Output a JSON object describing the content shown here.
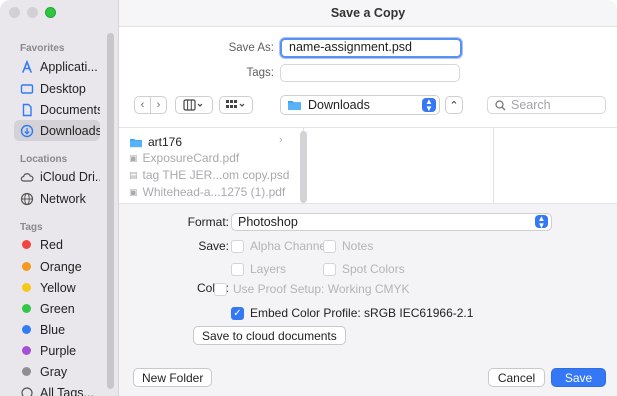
{
  "window": {
    "title": "Save a Copy"
  },
  "sidebar": {
    "favorites_label": "Favorites",
    "favorites": [
      {
        "label": "Applicati...",
        "icon": "applications-icon"
      },
      {
        "label": "Desktop",
        "icon": "desktop-icon"
      },
      {
        "label": "Documents",
        "icon": "document-icon"
      },
      {
        "label": "Downloads",
        "icon": "downloads-icon",
        "selected": true
      }
    ],
    "locations_label": "Locations",
    "locations": [
      {
        "label": "iCloud Dri...",
        "icon": "cloud-icon"
      },
      {
        "label": "Network",
        "icon": "network-icon"
      }
    ],
    "tags_label": "Tags",
    "tags": [
      {
        "label": "Red",
        "color": "#f2453d"
      },
      {
        "label": "Orange",
        "color": "#f39a1e"
      },
      {
        "label": "Yellow",
        "color": "#f5c81a"
      },
      {
        "label": "Green",
        "color": "#33c748"
      },
      {
        "label": "Blue",
        "color": "#2f7cf6"
      },
      {
        "label": "Purple",
        "color": "#a64fd6"
      },
      {
        "label": "Gray",
        "color": "#8e8e93"
      }
    ],
    "all_tags": "All Tags..."
  },
  "form": {
    "save_as_label": "Save As:",
    "save_as_value": "name-assignment.psd",
    "tags_label": "Tags:",
    "tags_value": ""
  },
  "toolbar": {
    "location": "Downloads",
    "search_placeholder": "Search"
  },
  "browser": {
    "files": [
      {
        "name": "art176",
        "type": "folder"
      },
      {
        "name": "ExposureCard.pdf",
        "type": "file"
      },
      {
        "name": "tag THE JER...om  copy.psd",
        "type": "file"
      },
      {
        "name": "Whitehead-a...1275 (1).pdf",
        "type": "file"
      }
    ]
  },
  "options": {
    "format_label": "Format:",
    "format_value": "Photoshop",
    "save_label": "Save:",
    "alpha_channels": "Alpha Channels",
    "notes": "Notes",
    "layers": "Layers",
    "spot_colors": "Spot Colors",
    "color_label": "Color:",
    "use_proof": "Use Proof Setup:  Working CMYK",
    "embed_profile": "Embed Color Profile:  sRGB IEC61966-2.1",
    "cloud_button": "Save to cloud documents"
  },
  "footer": {
    "new_folder": "New Folder",
    "cancel": "Cancel",
    "save": "Save"
  }
}
